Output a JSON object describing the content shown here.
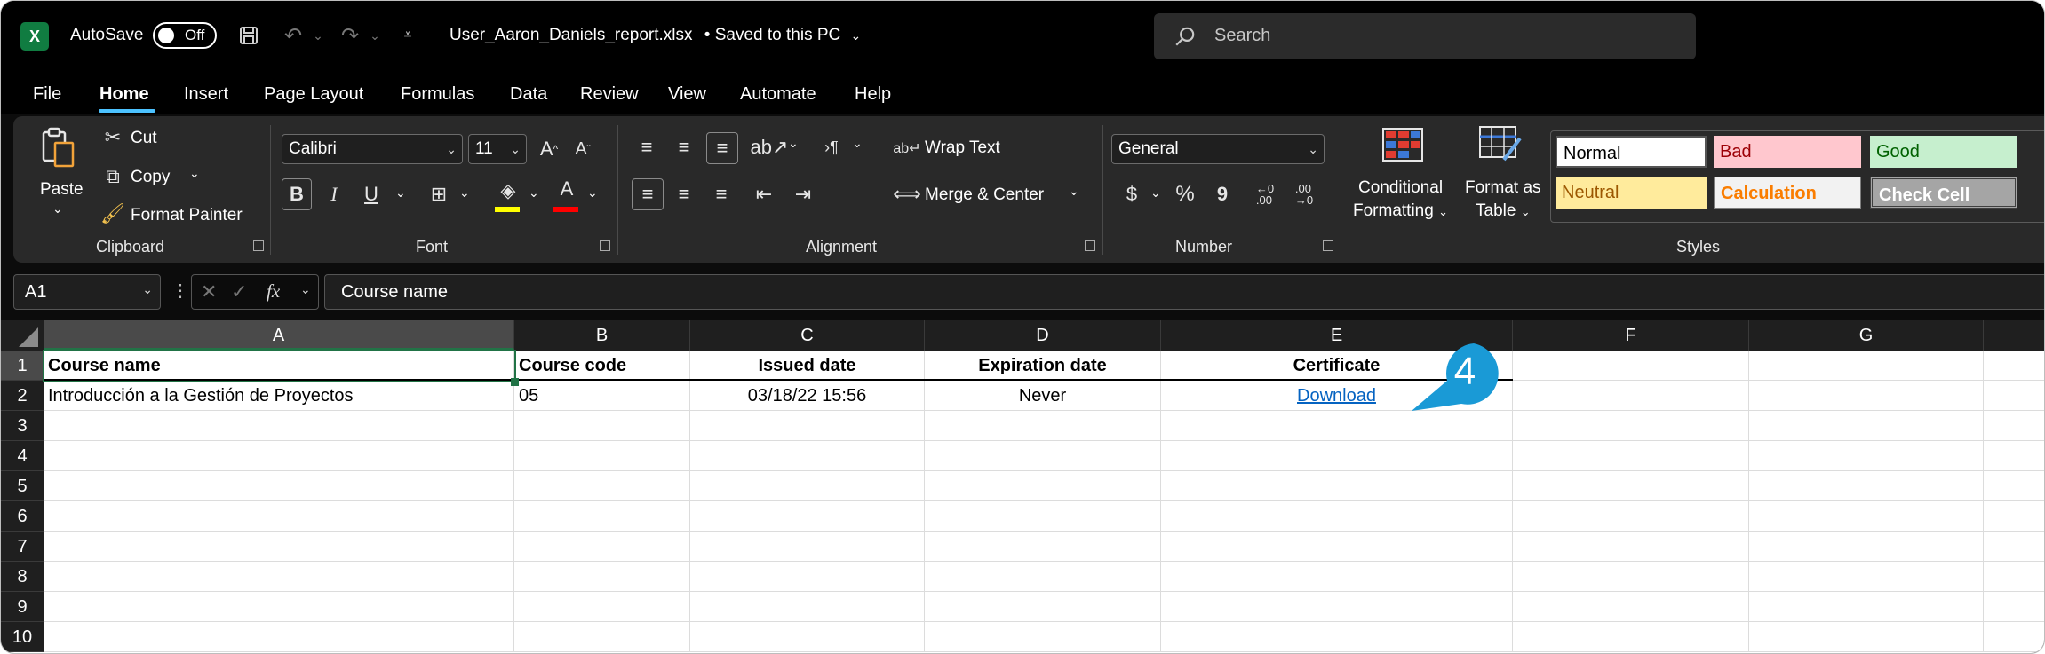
{
  "titlebar": {
    "app_logo": "X",
    "autosave_label": "AutoSave",
    "autosave_state": "Off",
    "document_title": "User_Aaron_Daniels_report.xlsx",
    "save_status": "• Saved to this PC",
    "search_placeholder": "Search"
  },
  "menu": {
    "items": [
      "File",
      "Home",
      "Insert",
      "Page Layout",
      "Formulas",
      "Data",
      "Review",
      "View",
      "Automate",
      "Help"
    ],
    "active": "Home"
  },
  "ribbon": {
    "clipboard": {
      "paste": "Paste",
      "cut": "Cut",
      "copy": "Copy",
      "format_painter": "Format Painter",
      "label": "Clipboard"
    },
    "font": {
      "font_name": "Calibri",
      "font_size": "11",
      "bold": "B",
      "italic": "I",
      "underline": "U",
      "label": "Font",
      "highlight_color": "#ffff00",
      "font_color": "#ff0000"
    },
    "alignment": {
      "wrap_text": "Wrap Text",
      "merge_center": "Merge & Center",
      "label": "Alignment"
    },
    "number": {
      "format": "General",
      "currency": "$",
      "percent": "%",
      "comma": "9",
      "label": "Number"
    },
    "styles": {
      "conditional_formatting_1": "Conditional",
      "conditional_formatting_2": "Formatting",
      "format_as_table_1": "Format as",
      "format_as_table_2": "Table",
      "label": "Styles",
      "cells": [
        {
          "name": "Normal",
          "bg": "#ffffff",
          "fg": "#000000"
        },
        {
          "name": "Bad",
          "bg": "#ffc7ce",
          "fg": "#9c0006"
        },
        {
          "name": "Good",
          "bg": "#c6efce",
          "fg": "#006100"
        },
        {
          "name": "Neutral",
          "bg": "#ffeb9c",
          "fg": "#9c5700"
        },
        {
          "name": "Calculation",
          "bg": "#f2f2f2",
          "fg": "#fa7d00"
        },
        {
          "name": "Check Cell",
          "bg": "#a5a5a5",
          "fg": "#ffffff"
        }
      ]
    }
  },
  "formula_bar": {
    "name_box": "A1",
    "fx": "fx",
    "formula": "Course name"
  },
  "sheet": {
    "columns": [
      "A",
      "B",
      "C",
      "D",
      "E",
      "F",
      "G"
    ],
    "rows": [
      "1",
      "2",
      "3",
      "4",
      "5",
      "6",
      "7",
      "8",
      "9",
      "10"
    ],
    "header_row": [
      "Course name",
      "Course code",
      "Issued date",
      "Expiration date",
      "Certificate"
    ],
    "data_row": [
      "Introducción a la Gestión de Proyectos",
      "05",
      "03/18/22 15:56",
      "Never",
      "Download"
    ],
    "active_cell": "A1"
  },
  "callout": {
    "number": "4",
    "color": "#1a9ad6"
  }
}
